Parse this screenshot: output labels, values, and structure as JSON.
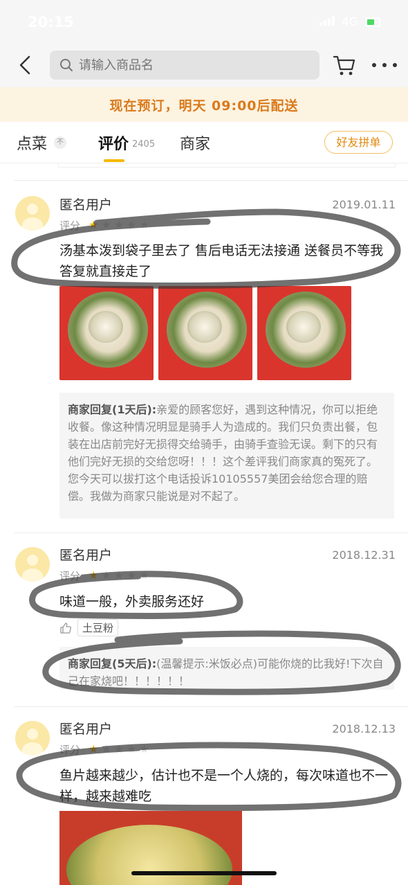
{
  "status_bar": {
    "time": "20:15",
    "network": "4G"
  },
  "nav": {
    "search_placeholder": "请输入商品名"
  },
  "banner": {
    "text": "现在预订，明天 09:00后配送"
  },
  "tabs": {
    "dish": "点菜",
    "dish_badge": "不",
    "review": "评价",
    "review_count": "2405",
    "merchant": "商家",
    "group_button": "好友拼单"
  },
  "reviews": [
    {
      "user": "匿名用户",
      "date": "2019.01.11",
      "rating_label": "评分",
      "stars": 1,
      "text": "汤基本泼到袋子里去了 售后电话无法接通 送餐员不等我答复就直接走了",
      "photos": 3,
      "reply_label": "商家回复(1天后):",
      "reply": "亲爱的顾客您好，遇到这种情况，你可以拒绝收餐。像这种情况明显是骑手人为造成的。我们只负责出餐，包装在出店前完好无损得交给骑手，由骑手查验无误。剩下的只有他们完好无损的交给您呀！！！这个差评我们商家真的冤死了。您今天可以拔打这个电话投诉10105557美团会给您合理的赔偿。我做为商家只能说是对不起了。"
    },
    {
      "user": "匿名用户",
      "date": "2018.12.31",
      "rating_label": "评分",
      "stars": 1,
      "text": "味道一般，外卖服务还好",
      "tag": "土豆粉",
      "reply_label": "商家回复(5天后):",
      "reply": "(温馨提示:米饭必点)可能你烧的比我好!下次自己在家烧吧！！！！！！"
    },
    {
      "user": "匿名用户",
      "date": "2018.12.13",
      "rating_label": "评分",
      "stars": 1,
      "text": "鱼片越来越少，估计也不是一个人烧的，每次味道也不一样，越来越难吃"
    }
  ],
  "colors": {
    "accent": "#f5b800",
    "banner_bg": "#fdf3e1",
    "banner_text": "#d97a1c",
    "scribble": "#3a3a3a"
  },
  "icons": [
    "back-icon",
    "search-icon",
    "cart-icon",
    "more-icon",
    "star-icon",
    "thumb-up-icon"
  ]
}
